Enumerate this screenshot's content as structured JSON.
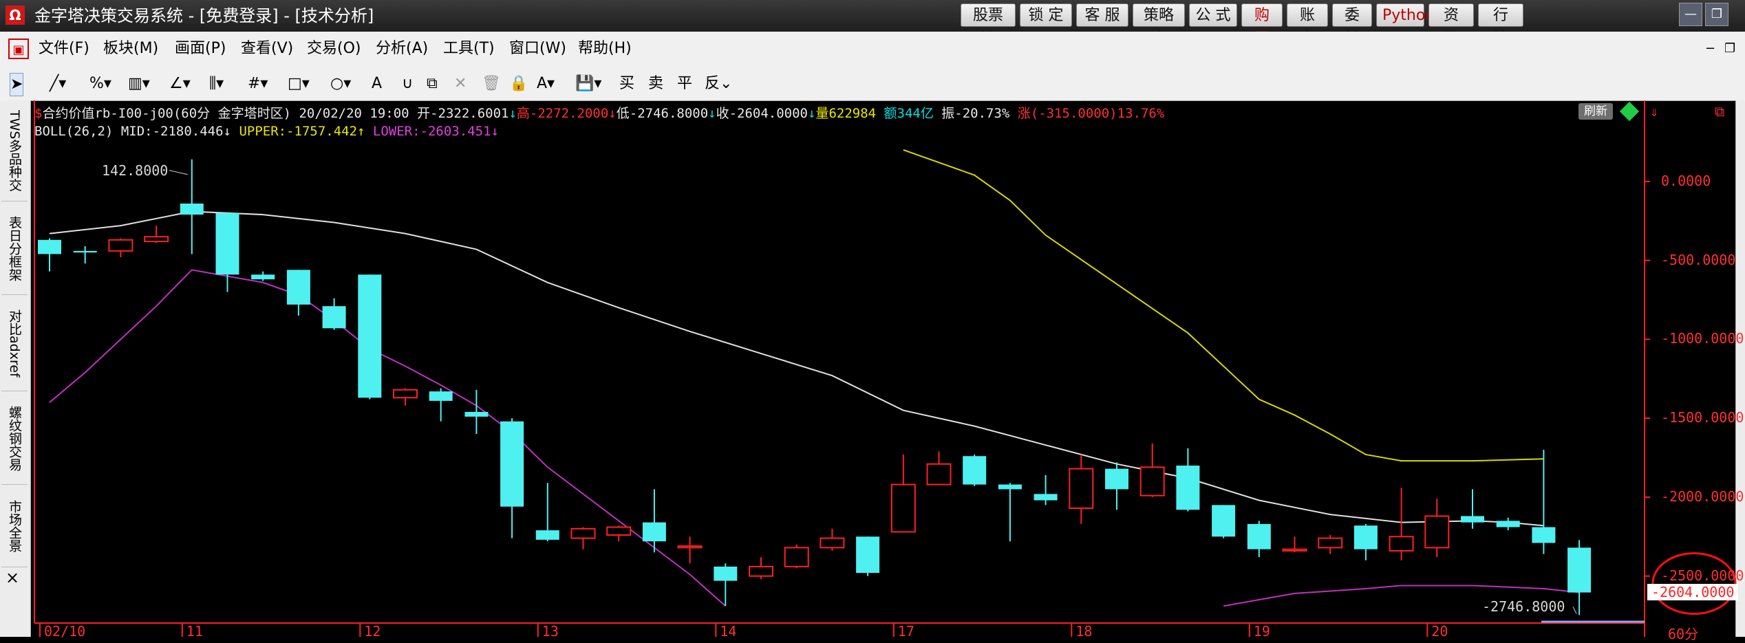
{
  "window": {
    "app_icon": "Ω",
    "title": "金字塔决策交易系统 - [免费登录] - [技术分析]",
    "buttons": [
      {
        "label": "股票池",
        "accent": false
      },
      {
        "label": "锁 定",
        "accent": false
      },
      {
        "label": "客 服",
        "accent": false
      },
      {
        "label": "策略库",
        "accent": false
      },
      {
        "label": "公 式",
        "accent": false
      },
      {
        "label": "购 买",
        "accent": true
      },
      {
        "label": "账 户",
        "accent": false
      },
      {
        "label": "委 托",
        "accent": false
      },
      {
        "label": "Python",
        "accent": true
      },
      {
        "label": "资 讯",
        "accent": false
      },
      {
        "label": "行 情",
        "accent": false
      }
    ],
    "minimize": "—",
    "restore": "❐"
  },
  "menu": {
    "items": [
      "文件(F)",
      "板块(M)",
      "画面(P)",
      "查看(V)",
      "交易(O)",
      "分析(A)",
      "工具(T)",
      "窗口(W)",
      "帮助(H)"
    ],
    "right_minimize": "−",
    "right_restore": "❐"
  },
  "toolbar": {
    "tools": [
      {
        "name": "pointer-tool-icon",
        "glyph": "➤",
        "selected": true
      },
      {
        "name": "line-tool-icon",
        "glyph": "╱▾"
      },
      {
        "name": "percent-tool-icon",
        "glyph": "%▾"
      },
      {
        "name": "ruler-tool-icon",
        "glyph": "▥▾"
      },
      {
        "name": "angle-tool-icon",
        "glyph": "∠▾"
      },
      {
        "name": "fib-tool-icon",
        "glyph": "⫼▾"
      },
      {
        "name": "grid-tool-icon",
        "glyph": "#▾"
      },
      {
        "name": "rect-tool-icon",
        "glyph": "□▾"
      },
      {
        "name": "ellipse-tool-icon",
        "glyph": "○▾"
      },
      {
        "name": "text-tool-icon",
        "glyph": "A"
      },
      {
        "name": "magnet-tool-icon",
        "glyph": "∪"
      },
      {
        "name": "copy-tool-icon",
        "glyph": "⧉"
      },
      {
        "name": "delete-tool-icon",
        "glyph": "✕",
        "disabled": true
      },
      {
        "name": "trash-tool-icon",
        "glyph": "🗑",
        "disabled": true
      },
      {
        "name": "lock-tool-icon",
        "glyph": "🔒"
      },
      {
        "name": "color-tool-icon",
        "glyph": "A▾"
      },
      {
        "name": "save-tool-icon",
        "glyph": "💾▾"
      },
      {
        "name": "buy-tool",
        "glyph": "买"
      },
      {
        "name": "sell-tool",
        "glyph": "卖"
      },
      {
        "name": "close-position-tool",
        "glyph": "平"
      },
      {
        "name": "reverse-tool",
        "glyph": "反⌄"
      }
    ]
  },
  "side_tabs": [
    "TWS多品种交",
    "表日分框架",
    "对比adxref",
    "螺纹钢交易",
    "市场全景"
  ],
  "side_close": "×",
  "header": {
    "line1": [
      {
        "text": "$",
        "color": "#ff3030"
      },
      {
        "text": "合约价值rb-I00-j00(60分 金字塔时区) 20/02/20 19:00 ",
        "color": "#e8e8e8"
      },
      {
        "text": "开-2322.6001",
        "color": "#e8e8e8"
      },
      {
        "text": "↓",
        "color": "#00e0e0"
      },
      {
        "text": "高-2272.2000",
        "color": "#ff3030"
      },
      {
        "text": "↓",
        "color": "#ff3030"
      },
      {
        "text": "低-2746.8000",
        "color": "#e8e8e8"
      },
      {
        "text": "↓",
        "color": "#00e0e0"
      },
      {
        "text": "收-2604.0000",
        "color": "#e8e8e8"
      },
      {
        "text": "↓",
        "color": "#00e0e0"
      },
      {
        "text": "量622984 ",
        "color": "#e8e800"
      },
      {
        "text": "额344亿 ",
        "color": "#00e0e0"
      },
      {
        "text": "振-20.73% ",
        "color": "#e8e8e8"
      },
      {
        "text": "涨(-315.0000)13.76%",
        "color": "#ff3030"
      }
    ],
    "line2": [
      {
        "text": "BOLL(26,2) MID:-2180.446",
        "color": "#e8e8e8"
      },
      {
        "text": "↓ ",
        "color": "#e8e8e8"
      },
      {
        "text": "UPPER:-1757.442",
        "color": "#e8e800"
      },
      {
        "text": "↑ ",
        "color": "#e8e800"
      },
      {
        "text": "LOWER:-2603.451",
        "color": "#e040e0"
      },
      {
        "text": "↓",
        "color": "#e040e0"
      }
    ],
    "refresh_badge": "刷新"
  },
  "chart_data": {
    "type": "candlestick",
    "timeframe": "60分",
    "ylim": [
      -2850,
      470
    ],
    "y_ticks": [
      0,
      -500,
      -1000,
      -1500,
      -2000,
      -2500
    ],
    "y_tick_labels": [
      "0.0000",
      "-500.0000",
      "-1000.0000",
      "-1500.0000",
      "-2000.0000",
      "-2500.0000"
    ],
    "x_date_labels": [
      {
        "label": "02/10",
        "index": 0
      },
      {
        "label": "11",
        "index": 4
      },
      {
        "label": "12",
        "index": 9
      },
      {
        "label": "13",
        "index": 14
      },
      {
        "label": "14",
        "index": 19
      },
      {
        "label": "17",
        "index": 24
      },
      {
        "label": "18",
        "index": 29
      },
      {
        "label": "19",
        "index": 34
      },
      {
        "label": "20",
        "index": 39
      }
    ],
    "time_unit_label": "60分",
    "colors": {
      "up": "#ff2020",
      "down": "#4ef0f0",
      "mid": "#e0e0e0",
      "upper": "#d8d800",
      "lower": "#c030c0",
      "axis": "#ff2020"
    },
    "candles": [
      {
        "o": -370,
        "c": -460,
        "h": -360,
        "l": -570
      },
      {
        "o": -440,
        "c": -450,
        "h": -410,
        "l": -520
      },
      {
        "o": -440,
        "c": -370,
        "h": -360,
        "l": -480
      },
      {
        "o": -380,
        "c": -350,
        "h": -280,
        "l": -390
      },
      {
        "o": -140,
        "c": -210,
        "h": 140,
        "l": -460
      },
      {
        "o": -200,
        "c": -590,
        "h": -200,
        "l": -700
      },
      {
        "o": -590,
        "c": -620,
        "h": -570,
        "l": -630
      },
      {
        "o": -560,
        "c": -780,
        "h": -560,
        "l": -850
      },
      {
        "o": -790,
        "c": -930,
        "h": -740,
        "l": -940
      },
      {
        "o": -590,
        "c": -1370,
        "h": -590,
        "l": -1380
      },
      {
        "o": -1370,
        "c": -1320,
        "h": -1310,
        "l": -1420
      },
      {
        "o": -1330,
        "c": -1390,
        "h": -1310,
        "l": -1520
      },
      {
        "o": -1460,
        "c": -1490,
        "h": -1320,
        "l": -1600
      },
      {
        "o": -1520,
        "c": -2060,
        "h": -1500,
        "l": -2260
      },
      {
        "o": -2210,
        "c": -2270,
        "h": -1910,
        "l": -2280
      },
      {
        "o": -2260,
        "c": -2200,
        "h": -2190,
        "l": -2330
      },
      {
        "o": -2240,
        "c": -2190,
        "h": -2180,
        "l": -2280
      },
      {
        "o": -2160,
        "c": -2280,
        "h": -1950,
        "l": -2350
      },
      {
        "o": -2320,
        "c": -2310,
        "h": -2250,
        "l": -2420
      },
      {
        "o": -2440,
        "c": -2530,
        "h": -2420,
        "l": -2690
      },
      {
        "o": -2500,
        "c": -2440,
        "h": -2380,
        "l": -2520
      },
      {
        "o": -2440,
        "c": -2320,
        "h": -2300,
        "l": -2450
      },
      {
        "o": -2320,
        "c": -2260,
        "h": -2200,
        "l": -2340
      },
      {
        "o": -2250,
        "c": -2480,
        "h": -2250,
        "l": -2500
      },
      {
        "o": -2220,
        "c": -1920,
        "h": -1730,
        "l": -2220
      },
      {
        "o": -1920,
        "c": -1790,
        "h": -1710,
        "l": -1920
      },
      {
        "o": -1740,
        "c": -1920,
        "h": -1730,
        "l": -1930
      },
      {
        "o": -1920,
        "c": -1950,
        "h": -1910,
        "l": -2280
      },
      {
        "o": -1980,
        "c": -2020,
        "h": -1860,
        "l": -2050
      },
      {
        "o": -2070,
        "c": -1820,
        "h": -1730,
        "l": -2170
      },
      {
        "o": -1820,
        "c": -1950,
        "h": -1780,
        "l": -2080
      },
      {
        "o": -1990,
        "c": -1810,
        "h": -1660,
        "l": -2000
      },
      {
        "o": -1800,
        "c": -2080,
        "h": -1690,
        "l": -2090
      },
      {
        "o": -2050,
        "c": -2250,
        "h": -2050,
        "l": -2260
      },
      {
        "o": -2170,
        "c": -2330,
        "h": -2150,
        "l": -2380
      },
      {
        "o": -2340,
        "c": -2330,
        "h": -2250,
        "l": -2350
      },
      {
        "o": -2320,
        "c": -2260,
        "h": -2240,
        "l": -2360
      },
      {
        "o": -2180,
        "c": -2330,
        "h": -2170,
        "l": -2400
      },
      {
        "o": -2340,
        "c": -2250,
        "h": -1940,
        "l": -2400
      },
      {
        "o": -2320,
        "c": -2120,
        "h": -2010,
        "l": -2380
      },
      {
        "o": -2120,
        "c": -2160,
        "h": -1950,
        "l": -2200
      },
      {
        "o": -2150,
        "c": -2190,
        "h": -2130,
        "l": -2210
      },
      {
        "o": -2190,
        "c": -2290,
        "h": -1700,
        "l": -2360
      },
      {
        "o": -2320,
        "c": -2604,
        "h": -2272,
        "l": -2746.8
      }
    ],
    "boll_mid": [
      [
        0,
        -330
      ],
      [
        2,
        -280
      ],
      [
        4,
        -190
      ],
      [
        6,
        -210
      ],
      [
        8,
        -260
      ],
      [
        10,
        -330
      ],
      [
        12,
        -430
      ],
      [
        14,
        -640
      ],
      [
        16,
        -800
      ],
      [
        18,
        -950
      ],
      [
        20,
        -1090
      ],
      [
        22,
        -1230
      ],
      [
        24,
        -1450
      ],
      [
        26,
        -1550
      ],
      [
        28,
        -1670
      ],
      [
        30,
        -1790
      ],
      [
        32,
        -1880
      ],
      [
        34,
        -2020
      ],
      [
        36,
        -2110
      ],
      [
        38,
        -2160
      ],
      [
        40,
        -2150
      ],
      [
        41,
        -2160
      ],
      [
        42,
        -2180.446
      ]
    ],
    "boll_upper": [
      [
        24,
        200
      ],
      [
        26,
        40
      ],
      [
        27,
        -120
      ],
      [
        28,
        -340
      ],
      [
        30,
        -650
      ],
      [
        32,
        -960
      ],
      [
        34,
        -1380
      ],
      [
        35,
        -1480
      ],
      [
        36,
        -1600
      ],
      [
        37,
        -1730
      ],
      [
        38,
        -1770
      ],
      [
        40,
        -1770
      ],
      [
        42,
        -1757.442
      ]
    ],
    "boll_lower_a": [
      [
        0,
        -1400
      ],
      [
        1,
        -1210
      ],
      [
        2,
        -1000
      ],
      [
        3,
        -790
      ],
      [
        4,
        -560
      ],
      [
        5,
        -600
      ],
      [
        6,
        -640
      ],
      [
        7,
        -720
      ],
      [
        8,
        -880
      ],
      [
        9,
        -1060
      ],
      [
        10,
        -1170
      ],
      [
        11,
        -1290
      ],
      [
        12,
        -1420
      ],
      [
        13,
        -1590
      ],
      [
        14,
        -1810
      ],
      [
        16,
        -2150
      ],
      [
        18,
        -2490
      ],
      [
        19,
        -2690
      ]
    ],
    "boll_lower_b": [
      [
        33,
        -2690
      ],
      [
        35,
        -2610
      ],
      [
        37,
        -2580
      ],
      [
        38,
        -2560
      ],
      [
        40,
        -2560
      ],
      [
        42,
        -2580
      ],
      [
        43,
        -2603.451
      ]
    ],
    "annotations": {
      "high_label": "142.8000",
      "low_label": "-2746.8000",
      "current_price": "-2604.0000",
      "current_price_index": 43
    }
  }
}
